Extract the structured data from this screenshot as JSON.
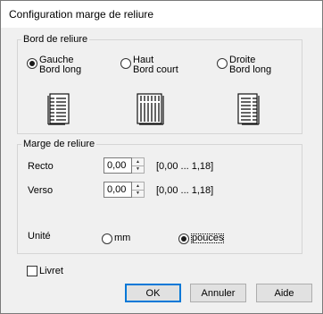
{
  "window": {
    "title": "Configuration marge de reliure"
  },
  "binding_edge": {
    "legend": "Bord de reliure",
    "options": [
      {
        "line1": "Gauche",
        "line2": "Bord long",
        "checked": true,
        "icon": "left-bound-document-icon"
      },
      {
        "line1": "Haut",
        "line2": "Bord court",
        "checked": false,
        "icon": "top-bound-document-icon"
      },
      {
        "line1": "Droite",
        "line2": "Bord long",
        "checked": false,
        "icon": "right-bound-document-icon"
      }
    ]
  },
  "binding_margin": {
    "legend": "Marge de reliure",
    "recto": {
      "label": "Recto",
      "value": "0,00",
      "range": "[0,00 ... 1,18]"
    },
    "verso": {
      "label": "Verso",
      "value": "0,00",
      "range": "[0,00 ... 1,18]"
    },
    "unit": {
      "label": "Unité",
      "options": [
        {
          "label": "mm",
          "checked": false
        },
        {
          "label": "pouces",
          "checked": true
        }
      ]
    }
  },
  "booklet": {
    "label": "Livret",
    "checked": false
  },
  "buttons": {
    "ok": "OK",
    "cancel": "Annuler",
    "help": "Aide"
  },
  "colors": {
    "accent": "#0078d7",
    "dialog_bg": "#f0f0f0",
    "group_border": "#d5d5d5"
  }
}
